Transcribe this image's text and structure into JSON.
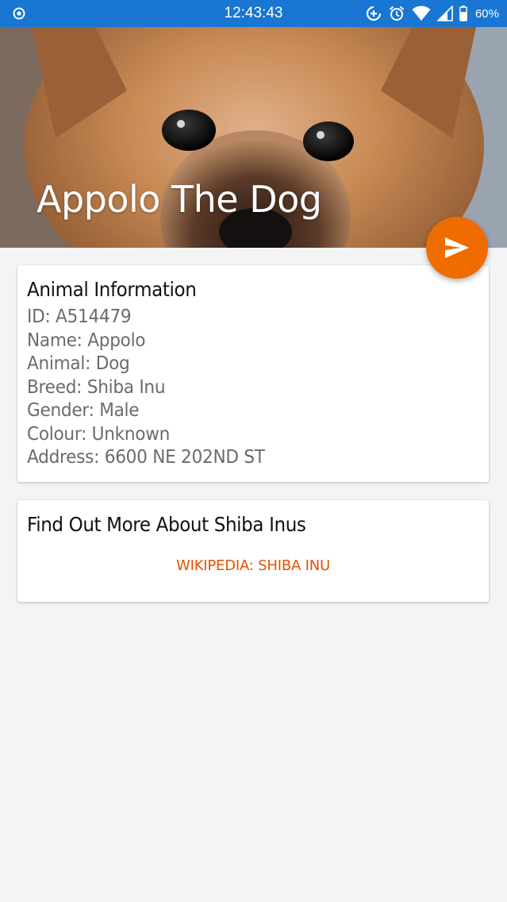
{
  "status_bar": {
    "time": "12:43:43",
    "battery": "60%",
    "icons": [
      "target-icon",
      "data-saver-icon",
      "alarm-icon",
      "wifi-icon",
      "signal-icon",
      "battery-icon"
    ]
  },
  "header": {
    "title": "Appolo The Dog",
    "image": "shiba-inu-puppy-photo"
  },
  "fab": {
    "icon": "send-icon",
    "color": "#ef6c00"
  },
  "animal_info": {
    "title": "Animal Information",
    "lines": [
      "ID: A514479",
      "Name: Appolo",
      "Animal: Dog",
      "Breed: Shiba Inu",
      "Gender: Male",
      "Colour: Unknown",
      "Address: 6600 NE 202ND ST"
    ]
  },
  "more_info": {
    "title": "Find Out More About Shiba Inus",
    "link_label": "WIKIPEDIA: SHIBA INU",
    "link_color": "#e65100"
  },
  "colors": {
    "status_bar": "#1976d2",
    "background": "#f4f4f4"
  }
}
